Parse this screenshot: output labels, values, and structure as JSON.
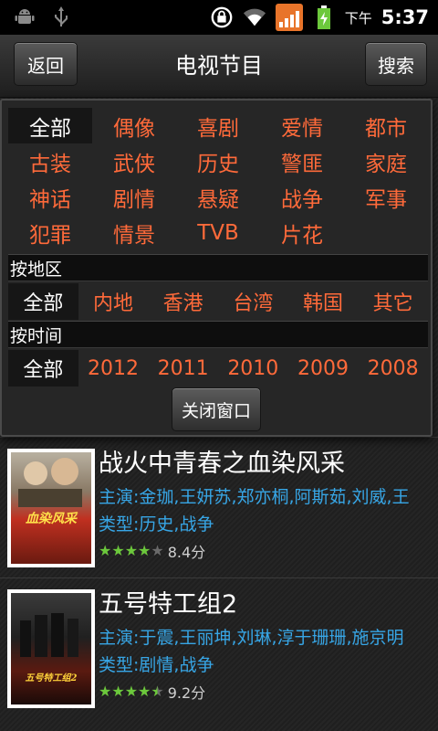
{
  "status_bar": {
    "left_icons": [
      "android-debug-icon",
      "usb-icon"
    ],
    "right_icons": [
      "screen-rotation-lock-icon",
      "wifi-icon",
      "carrier-signal-icon",
      "battery-charging-icon"
    ],
    "time_ampm": "下午",
    "time": "5:37"
  },
  "header": {
    "back_label": "返回",
    "title": "电视节目",
    "search_label": "搜索"
  },
  "filter_popup": {
    "genres": [
      "全部",
      "偶像",
      "喜剧",
      "爱情",
      "都市",
      "古装",
      "武侠",
      "历史",
      "警匪",
      "家庭",
      "神话",
      "剧情",
      "悬疑",
      "战争",
      "军事",
      "犯罪",
      "情景",
      "TVB",
      "片花"
    ],
    "selected_genre_index": 0,
    "region_header": "按地区",
    "regions": [
      "全部",
      "内地",
      "香港",
      "台湾",
      "韩国",
      "其它"
    ],
    "selected_region_index": 0,
    "time_header": "按时间",
    "years": [
      "全部",
      "2012",
      "2011",
      "2010",
      "2009",
      "2008"
    ],
    "selected_year_index": 0,
    "close_label": "关闭窗口"
  },
  "shows": [
    {
      "title": "战火中青春之血染风采",
      "cast": "主演:金珈,王妍苏,郑亦桐,阿斯茹,刘威,王",
      "type": "类型:历史,战争",
      "stars": 4,
      "score": "8.4分",
      "poster_caption": "血染风采"
    },
    {
      "title": "五号特工组2",
      "cast": "主演:于震,王丽坤,刘琳,淳于珊珊,施京明",
      "type": "类型:剧情,战争",
      "stars": 4.5,
      "score": "9.2分",
      "poster_caption": "五号特工组2"
    }
  ],
  "colors": {
    "accent_orange": "#ff6a3a",
    "link_blue": "#37a6e6",
    "star_green": "#6cc83c"
  }
}
